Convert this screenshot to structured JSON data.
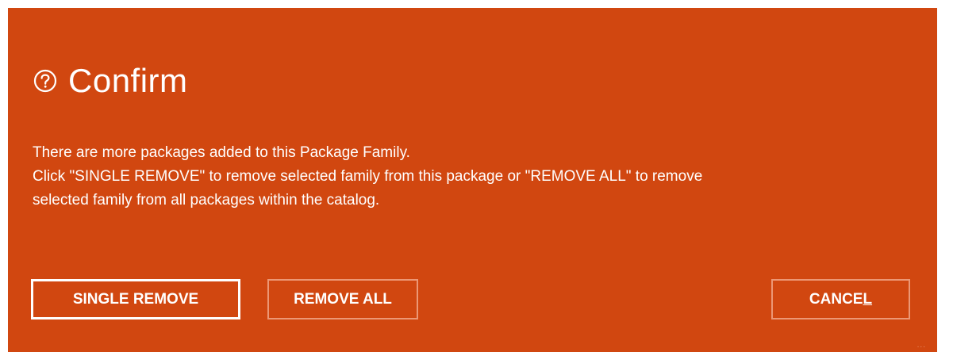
{
  "dialog": {
    "title": "Confirm",
    "icon": "question-circle-icon",
    "background_color": "#d14710",
    "message": {
      "line1": "There are more packages added to this Package Family.",
      "line2": "Click \"SINGLE REMOVE\" to remove selected family from this package or \"REMOVE ALL\" to remove",
      "line3": "selected family from all packages within the catalog."
    },
    "buttons": {
      "single_remove": "SINGLE REMOVE",
      "remove_all": "REMOVE ALL",
      "cancel_prefix": "CANCE",
      "cancel_accelerator": "L"
    },
    "grip": "..."
  }
}
